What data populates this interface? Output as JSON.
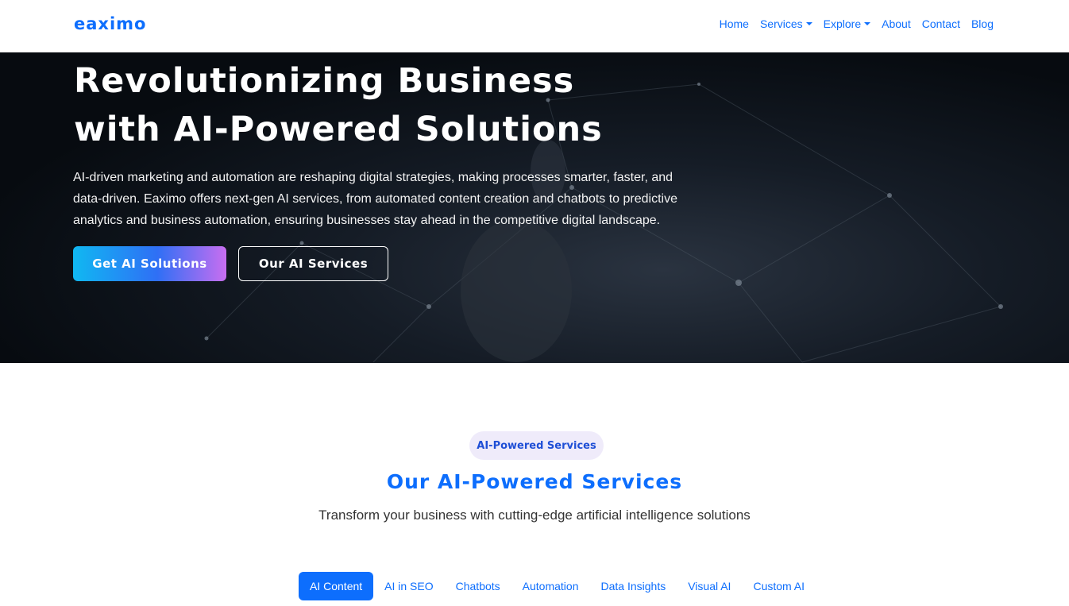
{
  "navbar": {
    "brand": "eaximo",
    "links": [
      {
        "label": "Home",
        "dropdown": false
      },
      {
        "label": "Services",
        "dropdown": true
      },
      {
        "label": "Explore",
        "dropdown": true
      },
      {
        "label": "About",
        "dropdown": false
      },
      {
        "label": "Contact",
        "dropdown": false
      },
      {
        "label": "Blog",
        "dropdown": false
      }
    ]
  },
  "hero": {
    "title_line1": "Revolutionizing Business",
    "title_line2": "with AI-Powered Solutions",
    "description": "AI-driven marketing and automation are reshaping digital strategies, making processes smarter, faster, and data-driven. Eaximo offers next-gen AI services, from automated content creation and chatbots to predictive analytics and business automation, ensuring businesses stay ahead in the competitive digital landscape.",
    "primary_button": "Get AI Solutions",
    "secondary_button": "Our AI Services"
  },
  "services": {
    "badge": "AI-Powered Services",
    "title": "Our AI-Powered Services",
    "subtitle": "Transform your business with cutting-edge artificial intelligence solutions",
    "tabs": [
      {
        "label": "AI Content",
        "active": true
      },
      {
        "label": "AI in SEO",
        "active": false
      },
      {
        "label": "Chatbots",
        "active": false
      },
      {
        "label": "Automation",
        "active": false
      },
      {
        "label": "Data Insights",
        "active": false
      },
      {
        "label": "Visual AI",
        "active": false
      },
      {
        "label": "Custom AI",
        "active": false
      }
    ]
  },
  "colors": {
    "brand_blue": "#0d6efd",
    "hero_dark": "#070b10",
    "badge_bg": "#efebfa"
  }
}
